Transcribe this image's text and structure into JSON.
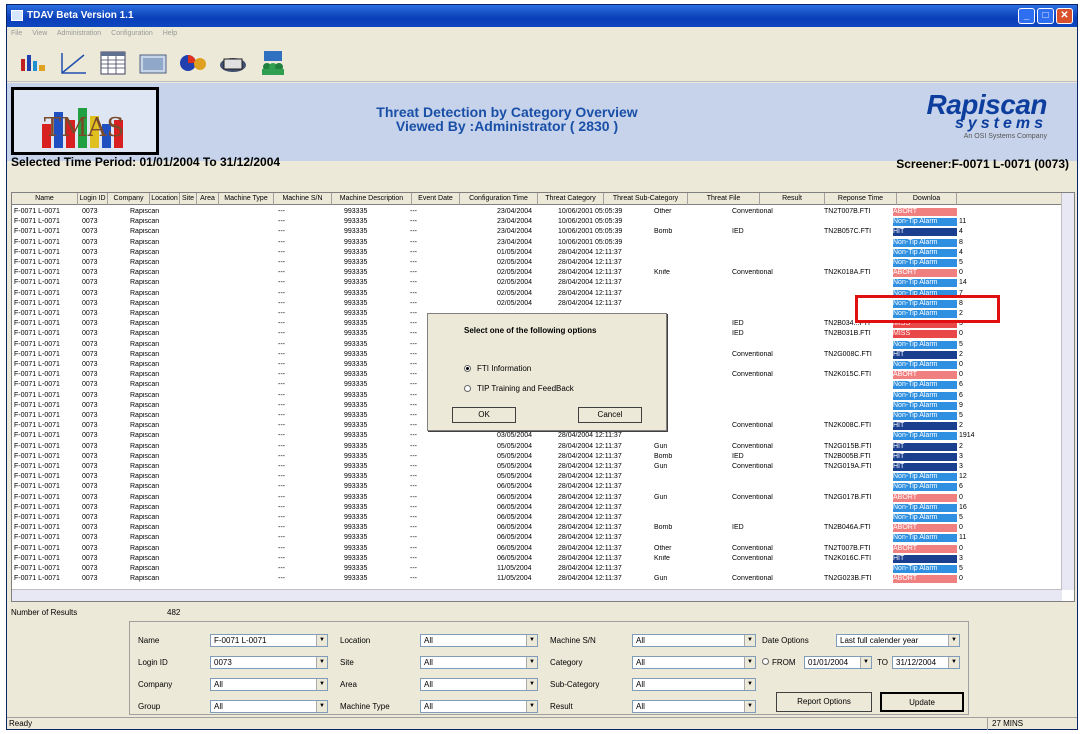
{
  "window": {
    "title": "TDAV Beta Version 1.1"
  },
  "menu": [
    "File",
    "View",
    "Administration",
    "Configuration",
    "Help"
  ],
  "header": {
    "line1": "Threat Detection by Category Overview",
    "line2": "Viewed By :Administrator  ( 2830 )",
    "logo": "TMAS",
    "brand": "Rapiscan",
    "brand_sub": "systems",
    "brand_tag": "An OSI Systems Company"
  },
  "period": "Selected Time Period: 01/01/2004 To 31/12/2004",
  "screener": "Screener:F-0071 L-0071 (0073)",
  "columns": [
    "Name",
    "Login ID",
    "Company",
    "Location",
    "Site",
    "Area",
    "Machine Type",
    "Machine S/N",
    "Machine Description",
    "Event Date",
    "Configuration Time",
    "Threat Category",
    "Threat Sub-Category",
    "Threat File",
    "Result",
    "Reponse Time",
    "Downloa"
  ],
  "rows": [
    [
      "23/04/2004",
      "10/06/2001 05:05:39",
      "Other",
      "Conventional",
      "TN2T007B.FTI",
      "ABORT",
      ""
    ],
    [
      "23/04/2004",
      "10/06/2001 05:05:39",
      "",
      "",
      "",
      "Non-Tip Alarm",
      "11"
    ],
    [
      "23/04/2004",
      "10/06/2001 05:05:39",
      "Bomb",
      "IED",
      "TN2B057C.FTI",
      "HIT",
      "4"
    ],
    [
      "23/04/2004",
      "10/06/2001 05:05:39",
      "",
      "",
      "",
      "Non-Tip Alarm",
      "8"
    ],
    [
      "01/05/2004",
      "28/04/2004 12:11:37",
      "",
      "",
      "",
      "Non-Tip Alarm",
      "4"
    ],
    [
      "02/05/2004",
      "28/04/2004 12:11:37",
      "",
      "",
      "",
      "Non-Tip Alarm",
      "5"
    ],
    [
      "02/05/2004",
      "28/04/2004 12:11:37",
      "Knife",
      "Conventional",
      "TN2K018A.FTI",
      "ABORT",
      "0"
    ],
    [
      "02/05/2004",
      "28/04/2004 12:11:37",
      "",
      "",
      "",
      "Non-Tip Alarm",
      "14"
    ],
    [
      "02/05/2004",
      "28/04/2004 12:11:37",
      "",
      "",
      "",
      "Non-Tip Alarm",
      "7"
    ],
    [
      "02/05/2004",
      "28/04/2004 12:11:37",
      "",
      "",
      "",
      "Non-Tip Alarm",
      "8"
    ],
    [
      "",
      "",
      "",
      "",
      "",
      "Non-Tip Alarm",
      "2"
    ],
    [
      "",
      "",
      "",
      "IED",
      "TN2B034...FTI",
      "MISS",
      "5"
    ],
    [
      "",
      "",
      "",
      "IED",
      "TN2B031B.FTI",
      "MISS",
      "0"
    ],
    [
      "",
      "",
      "",
      "",
      "",
      "Non-Tip Alarm",
      "5"
    ],
    [
      "",
      "",
      "",
      "Conventional",
      "TN2G008C.FTI",
      "HIT",
      "2"
    ],
    [
      "",
      "",
      "",
      "",
      "",
      "Non-Tip Alarm",
      "0"
    ],
    [
      "",
      "",
      "",
      "Conventional",
      "TN2K015C.FTI",
      "ABORT",
      "0"
    ],
    [
      "",
      "",
      "",
      "",
      "",
      "Non-Tip Alarm",
      "6"
    ],
    [
      "",
      "",
      "",
      "",
      "",
      "Non-Tip Alarm",
      "6"
    ],
    [
      "",
      "",
      "",
      "",
      "",
      "Non-Tip Alarm",
      "9"
    ],
    [
      "",
      "",
      "",
      "",
      "",
      "Non-Tip Alarm",
      "5"
    ],
    [
      "",
      "",
      "",
      "Conventional",
      "TN2K008C.FTI",
      "HIT",
      "2"
    ],
    [
      "03/05/2004",
      "28/04/2004 12:11:37",
      "",
      "",
      "",
      "Non-Tip Alarm",
      "1914"
    ],
    [
      "05/05/2004",
      "28/04/2004 12:11:37",
      "Gun",
      "Conventional",
      "TN2G015B.FTI",
      "HIT",
      "2"
    ],
    [
      "05/05/2004",
      "28/04/2004 12:11:37",
      "Bomb",
      "IED",
      "TN2B005B.FTI",
      "HIT",
      "3"
    ],
    [
      "05/05/2004",
      "28/04/2004 12:11:37",
      "Gun",
      "Conventional",
      "TN2G019A.FTI",
      "HIT",
      "3"
    ],
    [
      "05/05/2004",
      "28/04/2004 12:11:37",
      "",
      "",
      "",
      "Non-Tip Alarm",
      "12"
    ],
    [
      "06/05/2004",
      "28/04/2004 12:11:37",
      "",
      "",
      "",
      "Non-Tip Alarm",
      "6"
    ],
    [
      "06/05/2004",
      "28/04/2004 12:11:37",
      "Gun",
      "Conventional",
      "TN2G017B.FTI",
      "ABORT",
      "0"
    ],
    [
      "06/05/2004",
      "28/04/2004 12:11:37",
      "",
      "",
      "",
      "Non-Tip Alarm",
      "16"
    ],
    [
      "06/05/2004",
      "28/04/2004 12:11:37",
      "",
      "",
      "",
      "Non-Tip Alarm",
      "5"
    ],
    [
      "06/05/2004",
      "28/04/2004 12:11:37",
      "Bomb",
      "IED",
      "TN2B046A.FTI",
      "ABORT",
      "0"
    ],
    [
      "06/05/2004",
      "28/04/2004 12:11:37",
      "",
      "",
      "",
      "Non-Tip Alarm",
      "11"
    ],
    [
      "06/05/2004",
      "28/04/2004 12:11:37",
      "Other",
      "Conventional",
      "TN2T007B.FTI",
      "ABORT",
      "0"
    ],
    [
      "06/05/2004",
      "28/04/2004 12:11:37",
      "Knife",
      "Conventional",
      "TN2K016C.FTI",
      "HIT",
      "3"
    ],
    [
      "11/05/2004",
      "28/04/2004 12:11:37",
      "",
      "",
      "",
      "Non-Tip Alarm",
      "5"
    ],
    [
      "11/05/2004",
      "28/04/2004 12:11:37",
      "Gun",
      "Conventional",
      "TN2G023B.FTI",
      "ABORT",
      "0"
    ]
  ],
  "row_const": {
    "name": "F-0071 L-0071",
    "login": "0073",
    "company": "Rapiscan",
    "mtype": "---",
    "msn": "993335",
    "mdesc": "---"
  },
  "dialog": {
    "title": "Select one of the following options",
    "opt1": "FTI Information",
    "opt2": "TIP Training and FeedBack",
    "ok": "OK",
    "cancel": "Cancel"
  },
  "results": {
    "label": "Number of Results",
    "count": "482"
  },
  "filters": {
    "name_l": "Name",
    "name_v": "F-0071 L-0071",
    "login_l": "Login ID",
    "login_v": "0073",
    "company_l": "Company",
    "company_v": "All",
    "group_l": "Group",
    "group_v": "All",
    "location_l": "Location",
    "location_v": "All",
    "site_l": "Site",
    "site_v": "All",
    "area_l": "Area",
    "area_v": "All",
    "mtype_l": "Machine Type",
    "mtype_v": "All",
    "msn_l": "Machine S/N",
    "msn_v": "All",
    "category_l": "Category",
    "category_v": "All",
    "subcat_l": "Sub-Category",
    "subcat_v": "All",
    "result_l": "Result",
    "result_v": "All",
    "date_l": "Date Options",
    "date_v": "Last full calender year",
    "from_l": "FROM",
    "from_v": "01/01/2004",
    "to_l": "TO",
    "to_v": "31/12/2004",
    "report_btn": "Report Options",
    "update_btn": "Update"
  },
  "status": {
    "text": "Ready",
    "mins": "27 MINS"
  },
  "colors": {
    "abort": "#f08080",
    "hit": "#1a3f8f",
    "ntip": "#2f8fe0",
    "miss": "#e84848",
    "brand": "#0d3e9e",
    "title": "#1a4fa8"
  }
}
